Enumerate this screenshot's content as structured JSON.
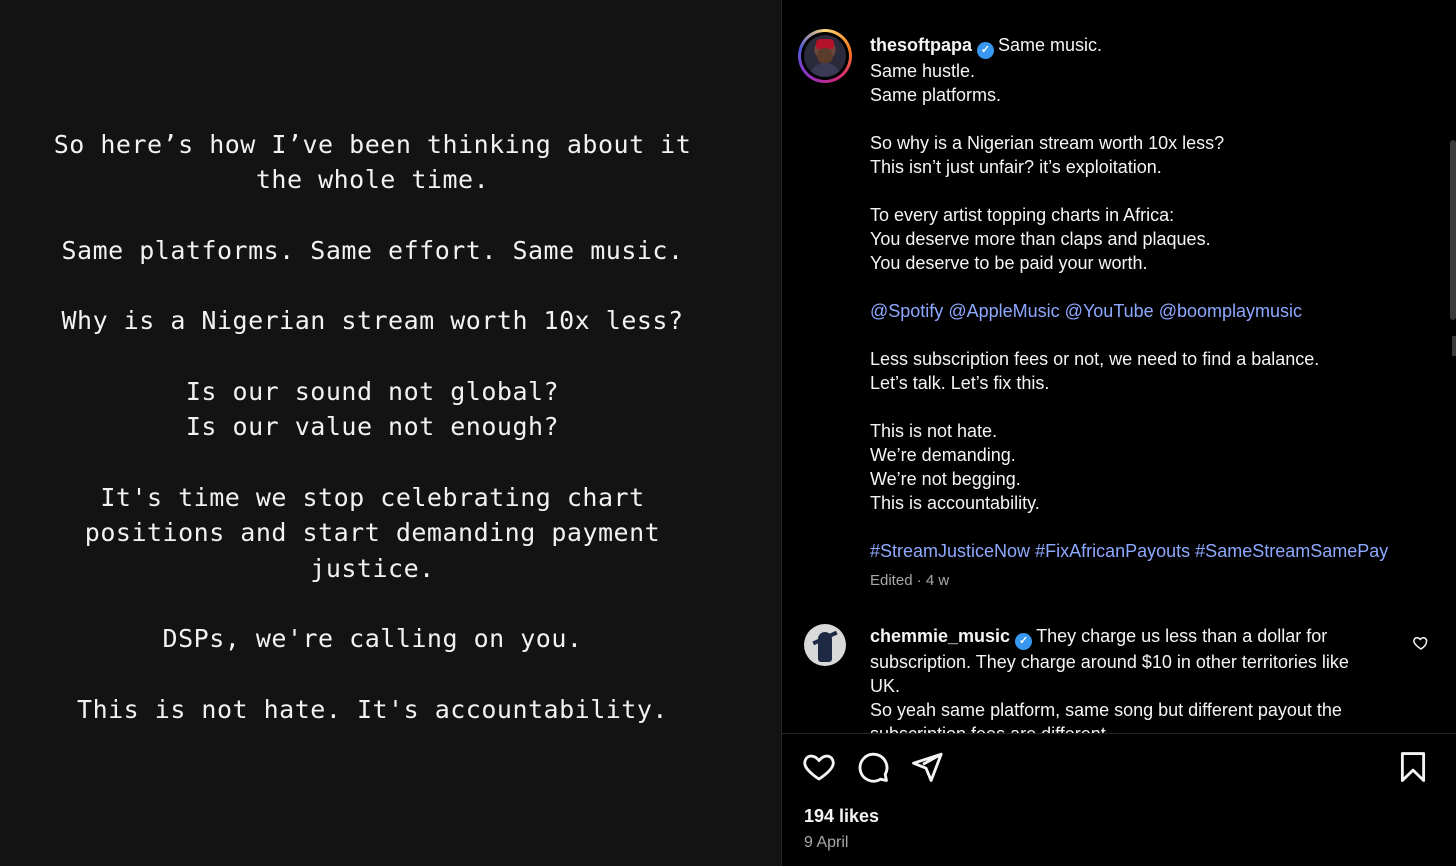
{
  "story_image": {
    "paragraphs": [
      [
        "So here’s how I’ve been thinking about it",
        "the whole time."
      ],
      [
        "Same platforms. Same effort. Same music."
      ],
      [
        "Why is a Nigerian stream worth 10x less?"
      ],
      [
        "Is our sound not global?",
        "Is our value not enough?"
      ],
      [
        "It's time we stop celebrating chart",
        "positions and start demanding payment",
        "justice."
      ],
      [
        "DSPs, we're calling on you."
      ],
      [
        "This is not hate. It's accountability."
      ]
    ]
  },
  "post": {
    "username": "thesoftpapa",
    "verified_glyph": "✓",
    "caption_first": "Same music.",
    "caption_lines": [
      "Same hustle.",
      "Same platforms.",
      "",
      "So why is a Nigerian stream worth 10x less?",
      "This isn’t just unfair? it’s exploitation.",
      "",
      "To every artist topping charts in Africa:",
      "You deserve more than claps and plaques.",
      "You deserve to be paid your worth.",
      ""
    ],
    "mentions": [
      "@Spotify",
      "@AppleMusic",
      "@YouTube",
      "@boomplaymusic"
    ],
    "caption_lines_2": [
      "",
      "Less subscription fees or not, we need to find a balance.",
      "Let’s talk. Let’s fix this.",
      "",
      "This is not hate.",
      "We’re demanding.",
      "We’re not begging.",
      "This is accountability.",
      ""
    ],
    "hashtags": [
      "#StreamJusticeNow",
      "#FixAfricanPayouts",
      "#SameStreamSamePay"
    ],
    "edited_label": "Edited · 4 w"
  },
  "comment": {
    "username": "chemmie_music",
    "verified_glyph": "✓",
    "text_first": "They charge us less than a dollar for",
    "text_lines": [
      "subscription. They charge around $10 in other territories like",
      "UK.",
      "So yeah same platform, same song but different payout the",
      "subscription fees are different"
    ]
  },
  "footer": {
    "likes": "194 likes",
    "date": "9 April"
  },
  "icons": {
    "like": "heart-icon",
    "comment": "comment-icon",
    "share": "share-icon",
    "save": "bookmark-icon"
  },
  "colors": {
    "link": "#8ea8ff",
    "verified": "#3897f0",
    "muted": "#a8a8a8"
  }
}
